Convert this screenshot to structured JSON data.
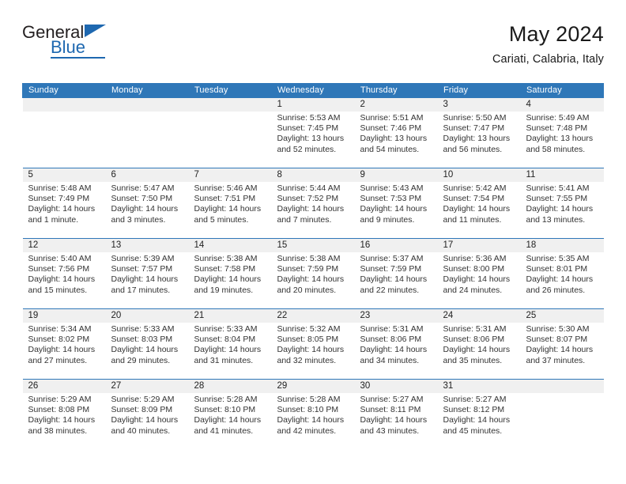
{
  "logo": {
    "word_general": "General",
    "word_blue": "Blue",
    "triangle_color": "#1e68b0"
  },
  "header": {
    "title": "May 2024",
    "subtitle": "Cariati, Calabria, Italy"
  },
  "theme": {
    "header_blue": "#2f77b8",
    "daynum_band": "#f0f0f0",
    "text": "#333333"
  },
  "weekday_headers": [
    "Sunday",
    "Monday",
    "Tuesday",
    "Wednesday",
    "Thursday",
    "Friday",
    "Saturday"
  ],
  "labels": {
    "sunrise_prefix": "Sunrise:",
    "sunset_prefix": "Sunset:",
    "daylight_prefix": "Daylight:"
  },
  "weeks": [
    [
      {
        "day": "",
        "empty": true
      },
      {
        "day": "",
        "empty": true
      },
      {
        "day": "",
        "empty": true
      },
      {
        "day": "1",
        "sunrise": "Sunrise: 5:53 AM",
        "sunset": "Sunset: 7:45 PM",
        "daylight_l1": "Daylight: 13 hours",
        "daylight_l2": "and 52 minutes."
      },
      {
        "day": "2",
        "sunrise": "Sunrise: 5:51 AM",
        "sunset": "Sunset: 7:46 PM",
        "daylight_l1": "Daylight: 13 hours",
        "daylight_l2": "and 54 minutes."
      },
      {
        "day": "3",
        "sunrise": "Sunrise: 5:50 AM",
        "sunset": "Sunset: 7:47 PM",
        "daylight_l1": "Daylight: 13 hours",
        "daylight_l2": "and 56 minutes."
      },
      {
        "day": "4",
        "sunrise": "Sunrise: 5:49 AM",
        "sunset": "Sunset: 7:48 PM",
        "daylight_l1": "Daylight: 13 hours",
        "daylight_l2": "and 58 minutes."
      }
    ],
    [
      {
        "day": "5",
        "sunrise": "Sunrise: 5:48 AM",
        "sunset": "Sunset: 7:49 PM",
        "daylight_l1": "Daylight: 14 hours",
        "daylight_l2": "and 1 minute."
      },
      {
        "day": "6",
        "sunrise": "Sunrise: 5:47 AM",
        "sunset": "Sunset: 7:50 PM",
        "daylight_l1": "Daylight: 14 hours",
        "daylight_l2": "and 3 minutes."
      },
      {
        "day": "7",
        "sunrise": "Sunrise: 5:46 AM",
        "sunset": "Sunset: 7:51 PM",
        "daylight_l1": "Daylight: 14 hours",
        "daylight_l2": "and 5 minutes."
      },
      {
        "day": "8",
        "sunrise": "Sunrise: 5:44 AM",
        "sunset": "Sunset: 7:52 PM",
        "daylight_l1": "Daylight: 14 hours",
        "daylight_l2": "and 7 minutes."
      },
      {
        "day": "9",
        "sunrise": "Sunrise: 5:43 AM",
        "sunset": "Sunset: 7:53 PM",
        "daylight_l1": "Daylight: 14 hours",
        "daylight_l2": "and 9 minutes."
      },
      {
        "day": "10",
        "sunrise": "Sunrise: 5:42 AM",
        "sunset": "Sunset: 7:54 PM",
        "daylight_l1": "Daylight: 14 hours",
        "daylight_l2": "and 11 minutes."
      },
      {
        "day": "11",
        "sunrise": "Sunrise: 5:41 AM",
        "sunset": "Sunset: 7:55 PM",
        "daylight_l1": "Daylight: 14 hours",
        "daylight_l2": "and 13 minutes."
      }
    ],
    [
      {
        "day": "12",
        "sunrise": "Sunrise: 5:40 AM",
        "sunset": "Sunset: 7:56 PM",
        "daylight_l1": "Daylight: 14 hours",
        "daylight_l2": "and 15 minutes."
      },
      {
        "day": "13",
        "sunrise": "Sunrise: 5:39 AM",
        "sunset": "Sunset: 7:57 PM",
        "daylight_l1": "Daylight: 14 hours",
        "daylight_l2": "and 17 minutes."
      },
      {
        "day": "14",
        "sunrise": "Sunrise: 5:38 AM",
        "sunset": "Sunset: 7:58 PM",
        "daylight_l1": "Daylight: 14 hours",
        "daylight_l2": "and 19 minutes."
      },
      {
        "day": "15",
        "sunrise": "Sunrise: 5:38 AM",
        "sunset": "Sunset: 7:59 PM",
        "daylight_l1": "Daylight: 14 hours",
        "daylight_l2": "and 20 minutes."
      },
      {
        "day": "16",
        "sunrise": "Sunrise: 5:37 AM",
        "sunset": "Sunset: 7:59 PM",
        "daylight_l1": "Daylight: 14 hours",
        "daylight_l2": "and 22 minutes."
      },
      {
        "day": "17",
        "sunrise": "Sunrise: 5:36 AM",
        "sunset": "Sunset: 8:00 PM",
        "daylight_l1": "Daylight: 14 hours",
        "daylight_l2": "and 24 minutes."
      },
      {
        "day": "18",
        "sunrise": "Sunrise: 5:35 AM",
        "sunset": "Sunset: 8:01 PM",
        "daylight_l1": "Daylight: 14 hours",
        "daylight_l2": "and 26 minutes."
      }
    ],
    [
      {
        "day": "19",
        "sunrise": "Sunrise: 5:34 AM",
        "sunset": "Sunset: 8:02 PM",
        "daylight_l1": "Daylight: 14 hours",
        "daylight_l2": "and 27 minutes."
      },
      {
        "day": "20",
        "sunrise": "Sunrise: 5:33 AM",
        "sunset": "Sunset: 8:03 PM",
        "daylight_l1": "Daylight: 14 hours",
        "daylight_l2": "and 29 minutes."
      },
      {
        "day": "21",
        "sunrise": "Sunrise: 5:33 AM",
        "sunset": "Sunset: 8:04 PM",
        "daylight_l1": "Daylight: 14 hours",
        "daylight_l2": "and 31 minutes."
      },
      {
        "day": "22",
        "sunrise": "Sunrise: 5:32 AM",
        "sunset": "Sunset: 8:05 PM",
        "daylight_l1": "Daylight: 14 hours",
        "daylight_l2": "and 32 minutes."
      },
      {
        "day": "23",
        "sunrise": "Sunrise: 5:31 AM",
        "sunset": "Sunset: 8:06 PM",
        "daylight_l1": "Daylight: 14 hours",
        "daylight_l2": "and 34 minutes."
      },
      {
        "day": "24",
        "sunrise": "Sunrise: 5:31 AM",
        "sunset": "Sunset: 8:06 PM",
        "daylight_l1": "Daylight: 14 hours",
        "daylight_l2": "and 35 minutes."
      },
      {
        "day": "25",
        "sunrise": "Sunrise: 5:30 AM",
        "sunset": "Sunset: 8:07 PM",
        "daylight_l1": "Daylight: 14 hours",
        "daylight_l2": "and 37 minutes."
      }
    ],
    [
      {
        "day": "26",
        "sunrise": "Sunrise: 5:29 AM",
        "sunset": "Sunset: 8:08 PM",
        "daylight_l1": "Daylight: 14 hours",
        "daylight_l2": "and 38 minutes."
      },
      {
        "day": "27",
        "sunrise": "Sunrise: 5:29 AM",
        "sunset": "Sunset: 8:09 PM",
        "daylight_l1": "Daylight: 14 hours",
        "daylight_l2": "and 40 minutes."
      },
      {
        "day": "28",
        "sunrise": "Sunrise: 5:28 AM",
        "sunset": "Sunset: 8:10 PM",
        "daylight_l1": "Daylight: 14 hours",
        "daylight_l2": "and 41 minutes."
      },
      {
        "day": "29",
        "sunrise": "Sunrise: 5:28 AM",
        "sunset": "Sunset: 8:10 PM",
        "daylight_l1": "Daylight: 14 hours",
        "daylight_l2": "and 42 minutes."
      },
      {
        "day": "30",
        "sunrise": "Sunrise: 5:27 AM",
        "sunset": "Sunset: 8:11 PM",
        "daylight_l1": "Daylight: 14 hours",
        "daylight_l2": "and 43 minutes."
      },
      {
        "day": "31",
        "sunrise": "Sunrise: 5:27 AM",
        "sunset": "Sunset: 8:12 PM",
        "daylight_l1": "Daylight: 14 hours",
        "daylight_l2": "and 45 minutes."
      },
      {
        "day": "",
        "empty": true
      }
    ]
  ]
}
